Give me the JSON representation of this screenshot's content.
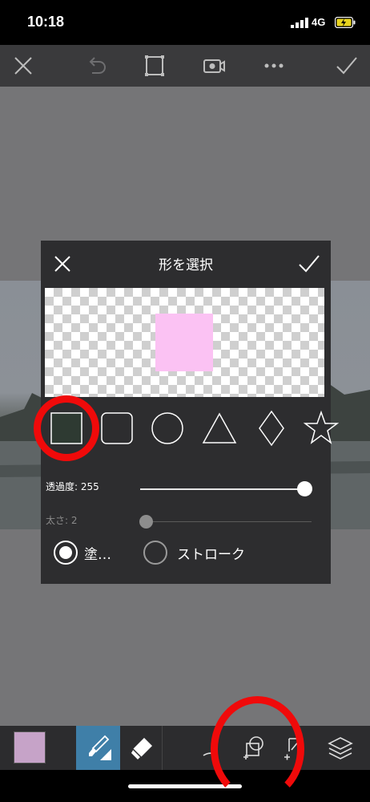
{
  "status": {
    "time": "10:18",
    "network": "4G"
  },
  "dialog": {
    "title": "形を選択",
    "opacity_label": "透過度: 255",
    "opacity_value": 255,
    "thickness_label": "太さ: 2",
    "thickness_value": 2,
    "fill_label": "塗…",
    "stroke_label": "ストローク",
    "fill_selected": true,
    "preview_color": "#fbc2f3",
    "shapes": [
      "square-icon",
      "rounded-square-icon",
      "circle-icon",
      "triangle-icon",
      "diamond-icon",
      "star-icon"
    ],
    "selected_shape": "square"
  },
  "toolbar_top": [
    "close-icon",
    "undo-icon",
    "crop-icon",
    "video-icon",
    "more-icon",
    "check-icon"
  ],
  "toolbar_bottom": [
    "color-swatch",
    "brush-icon",
    "eraser-icon",
    "curve-icon",
    "shape-add-icon",
    "draw-add-icon",
    "layers-icon"
  ],
  "colors": {
    "swatch": "#c6a3c8",
    "accent_selected": "#3f7fa8",
    "annotation": "#f00a0a"
  }
}
